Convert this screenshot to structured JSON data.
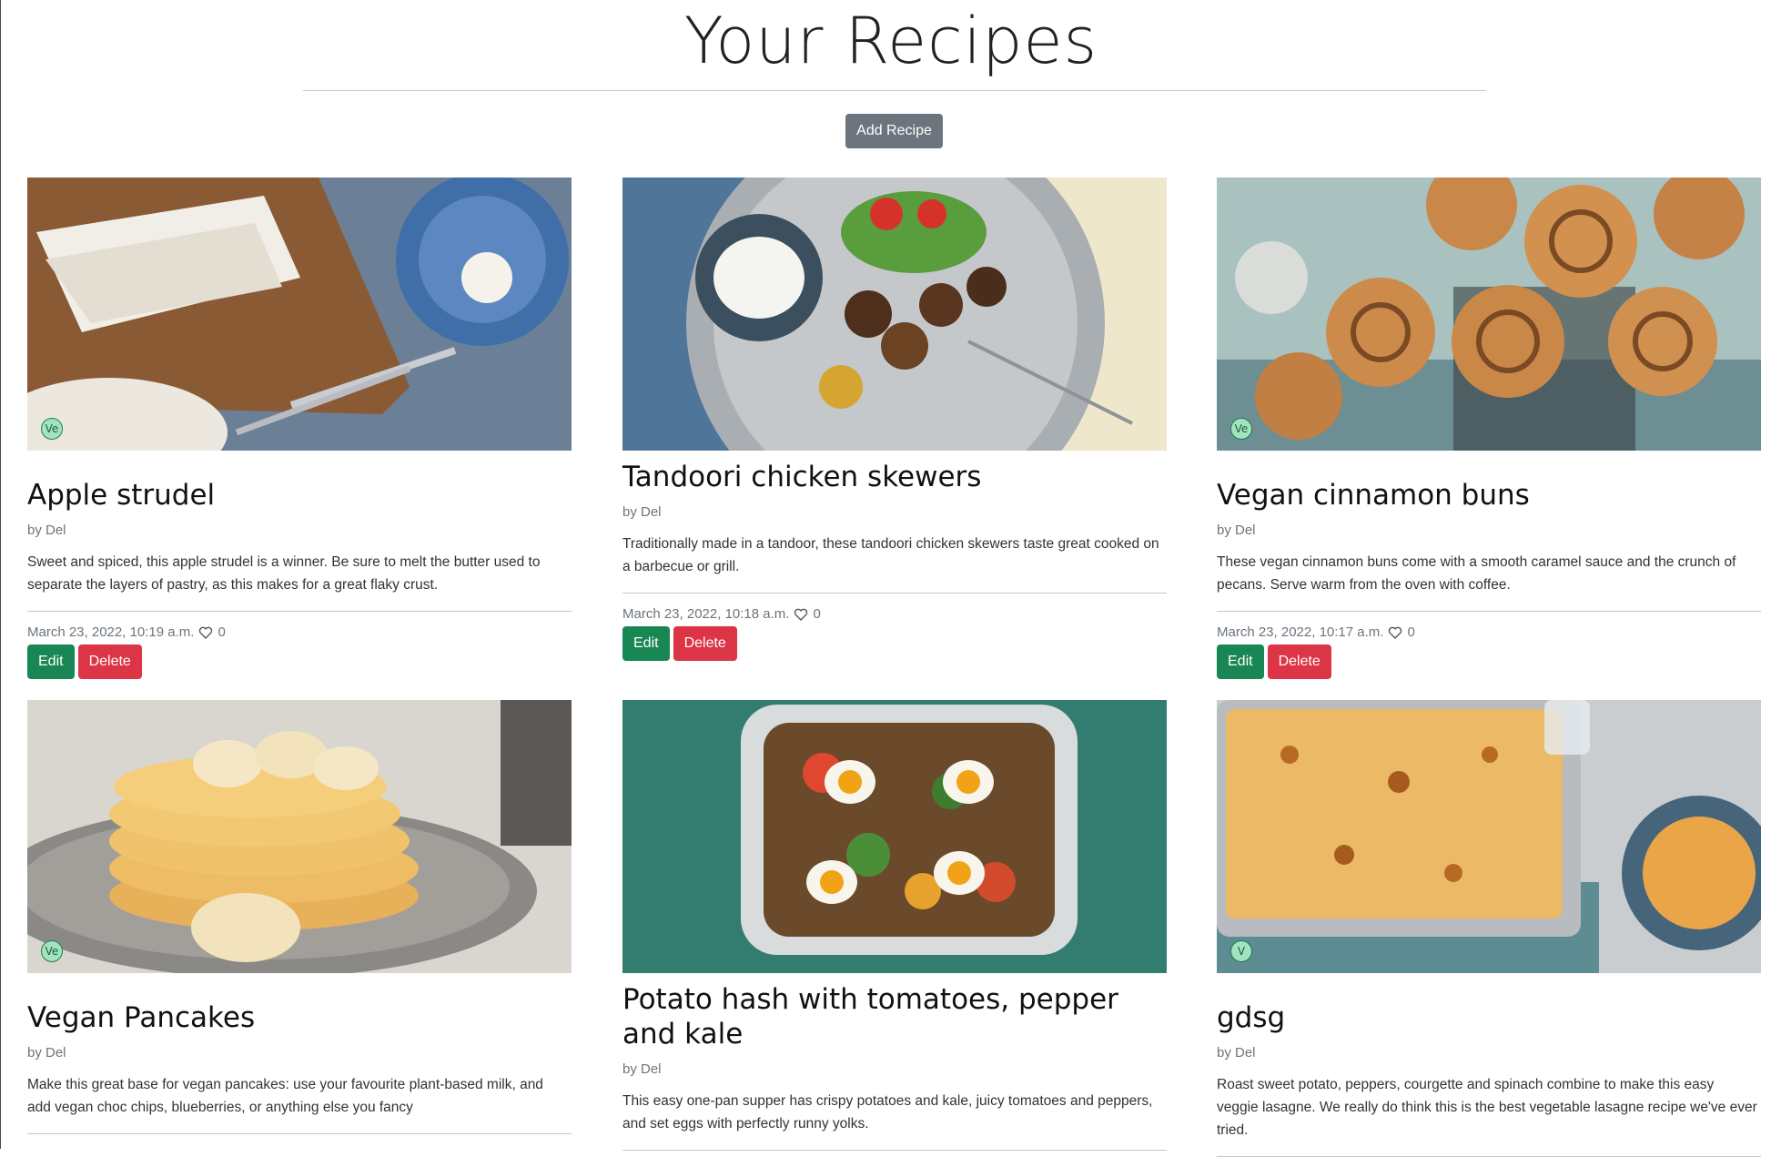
{
  "page": {
    "title": "Your Recipes",
    "add_button": "Add Recipe"
  },
  "recipes": [
    {
      "title": "Apple strudel",
      "author": "by Del",
      "description": "Sweet and spiced, this apple strudel is a winner. Be sure to melt the butter used to separate the layers of pastry, as this makes for a great flaky crust.",
      "date": "March 23, 2022, 10:19 a.m.",
      "likes": "0",
      "diet_badge": "Ve",
      "edit_label": "Edit",
      "delete_label": "Delete"
    },
    {
      "title": "Tandoori chicken skewers",
      "author": "by Del",
      "description": "Traditionally made in a tandoor, these tandoori chicken skewers taste great cooked on a barbecue or grill.",
      "date": "March 23, 2022, 10:18 a.m.",
      "likes": "0",
      "diet_badge": "",
      "edit_label": "Edit",
      "delete_label": "Delete"
    },
    {
      "title": "Vegan cinnamon buns",
      "author": "by Del",
      "description": "These vegan cinnamon buns come with a smooth caramel sauce and the crunch of pecans. Serve warm from the oven with coffee.",
      "date": "March 23, 2022, 10:17 a.m.",
      "likes": "0",
      "diet_badge": "Ve",
      "edit_label": "Edit",
      "delete_label": "Delete"
    },
    {
      "title": "Vegan Pancakes",
      "author": "by Del",
      "description": "Make this great base for vegan pancakes: use your favourite plant-based milk, and add vegan choc chips, blueberries, or anything else you fancy",
      "diet_badge": "Ve"
    },
    {
      "title": "Potato hash with tomatoes, pepper and kale",
      "author": "by Del",
      "description": "This easy one-pan supper has crispy potatoes and kale, juicy tomatoes and peppers, and set eggs with perfectly runny yolks.",
      "diet_badge": ""
    },
    {
      "title": "gdsg",
      "author": "by Del",
      "description": "Roast sweet potato, peppers, courgette and spinach combine to make this easy veggie lasagne. We really do think this is the best vegetable lasagne recipe we've ever tried.",
      "diet_badge": "V"
    }
  ],
  "colors": {
    "add_button": "#6c757d",
    "edit_button": "#198754",
    "delete_button": "#dc3545",
    "badge_fill": "#a3e4c0"
  }
}
